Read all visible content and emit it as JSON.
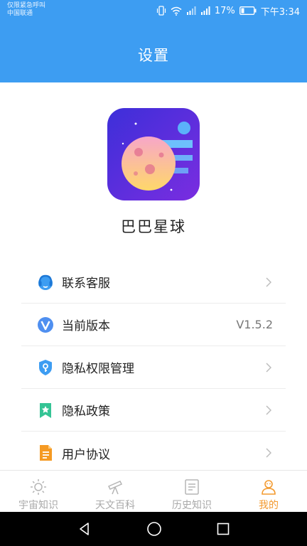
{
  "status_bar": {
    "carrier_line1": "仅限紧急呼叫",
    "carrier_line2": "中国联通",
    "battery": "17%",
    "time": "下午3:34"
  },
  "header": {
    "title": "设置"
  },
  "app": {
    "name": "巴巴星球"
  },
  "menu": [
    {
      "label": "联系客服",
      "icon": "headset-icon"
    },
    {
      "label": "当前版本",
      "icon": "version-icon",
      "value": "V1.5.2"
    },
    {
      "label": "隐私权限管理",
      "icon": "shield-key-icon"
    },
    {
      "label": "隐私政策",
      "icon": "bookmark-star-icon"
    },
    {
      "label": "用户协议",
      "icon": "document-icon"
    }
  ],
  "tabs": [
    {
      "label": "宇宙知识",
      "icon": "sun-icon",
      "active": false
    },
    {
      "label": "天文百科",
      "icon": "telescope-icon",
      "active": false
    },
    {
      "label": "历史知识",
      "icon": "notes-icon",
      "active": false
    },
    {
      "label": "我的",
      "icon": "profile-icon",
      "active": true
    }
  ],
  "colors": {
    "header": "#3d9df2",
    "accent": "#f39a2f",
    "inactive_tab": "#a9a9a9"
  }
}
